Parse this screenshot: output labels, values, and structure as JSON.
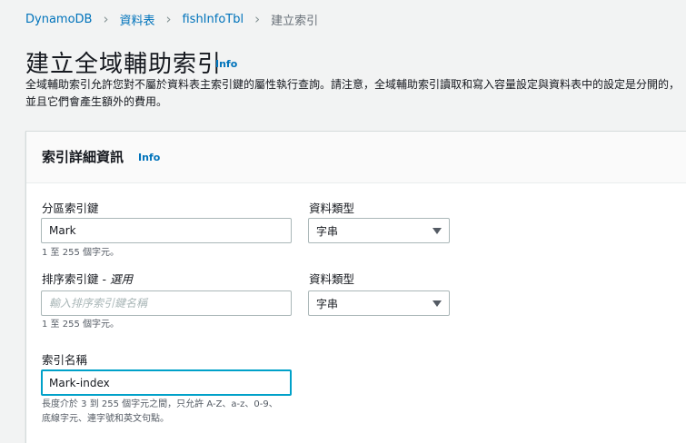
{
  "breadcrumb": {
    "items": [
      "DynamoDB",
      "資料表",
      "fishInfoTbl"
    ],
    "current": "建立索引"
  },
  "page": {
    "title": "建立全域輔助索引",
    "info": "Info",
    "description": "全域輔助索引允許您對不屬於資料表主索引鍵的屬性執行查詢。請注意，全域輔助索引讀取和寫入容量設定與資料表中的設定是分開的，並且它們會產生額外的費用。"
  },
  "panel": {
    "title": "索引詳細資訊",
    "info": "Info",
    "partition_key": {
      "label": "分區索引鍵",
      "value": "Mark",
      "hint": "1 至 255 個字元。",
      "type_label": "資料類型",
      "type_value": "字串"
    },
    "sort_key": {
      "label": "排序索引鍵 - ",
      "optional": "選用",
      "placeholder": "輸入排序索引鍵名稱",
      "hint": "1 至 255 個字元。",
      "type_label": "資料類型",
      "type_value": "字串"
    },
    "index_name": {
      "label": "索引名稱",
      "value": "Mark-index",
      "hint_line1": "長度介於 3 到 255 個字元之間，只允許 A-Z、a-z、0-9、",
      "hint_line2": "底線字元、連字號和英文句點。"
    }
  },
  "colors": {
    "link": "#0073bb",
    "focus": "#00a1c9",
    "border": "#aab7b8"
  }
}
